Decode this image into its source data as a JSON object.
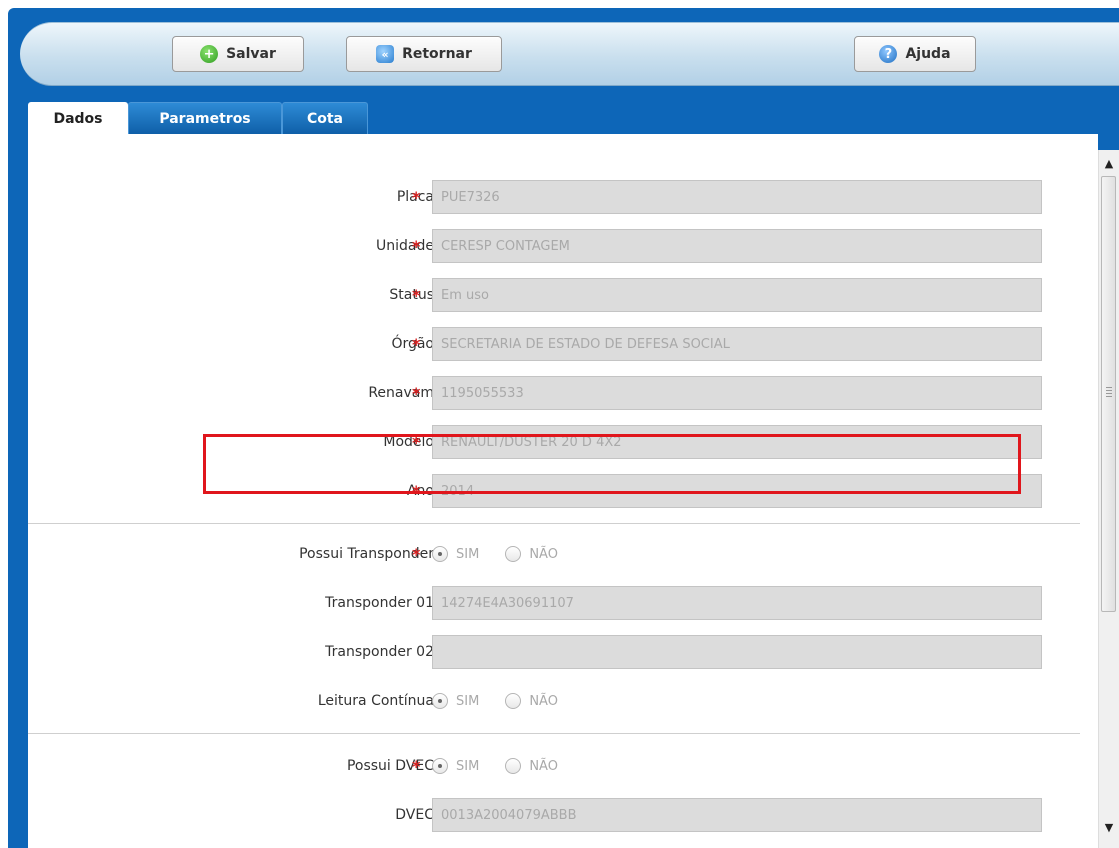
{
  "toolbar": {
    "save_label": "Salvar",
    "return_label": "Retornar",
    "help_label": "Ajuda"
  },
  "tabs": [
    {
      "label": "Dados",
      "active": true
    },
    {
      "label": "Parametros",
      "active": false
    },
    {
      "label": "Cota",
      "active": false
    }
  ],
  "form": {
    "placa": {
      "label": "Placa",
      "value": "PUE7326"
    },
    "unidade": {
      "label": "Unidade",
      "value": "CERESP CONTAGEM"
    },
    "status": {
      "label": "Status",
      "value": "Em uso"
    },
    "orgao": {
      "label": "Órgão",
      "value": "SECRETARIA DE ESTADO DE DEFESA SOCIAL"
    },
    "renavam": {
      "label": "Renavam",
      "value": "1195055533"
    },
    "modelo": {
      "label": "Modelo",
      "value": "RENAULT/DUSTER 20 D 4X2"
    },
    "ano": {
      "label": "Ano",
      "value": "2014"
    },
    "possui_transponder": {
      "label": "Possui Transponder",
      "yes": "SIM",
      "no": "NÃO",
      "selected": "SIM"
    },
    "transponder01": {
      "label": "Transponder 01",
      "value": "14274E4A30691107"
    },
    "transponder02": {
      "label": "Transponder 02",
      "value": ""
    },
    "leitura_continua": {
      "label": "Leitura Contínua",
      "yes": "SIM",
      "no": "NÃO",
      "selected": "SIM"
    },
    "possui_dvec": {
      "label": "Possui DVEC",
      "yes": "SIM",
      "no": "NÃO",
      "selected": "SIM"
    },
    "dvec": {
      "label": "DVEC",
      "value": "0013A2004079ABBB"
    }
  },
  "colors": {
    "frame_blue": "#0d66b8",
    "required": "#d82020",
    "highlight": "#e0161c",
    "field_bg": "#dcdcdc"
  },
  "icons": {
    "save": "plus-circle-icon",
    "return": "rewind-icon",
    "help": "question-icon"
  }
}
